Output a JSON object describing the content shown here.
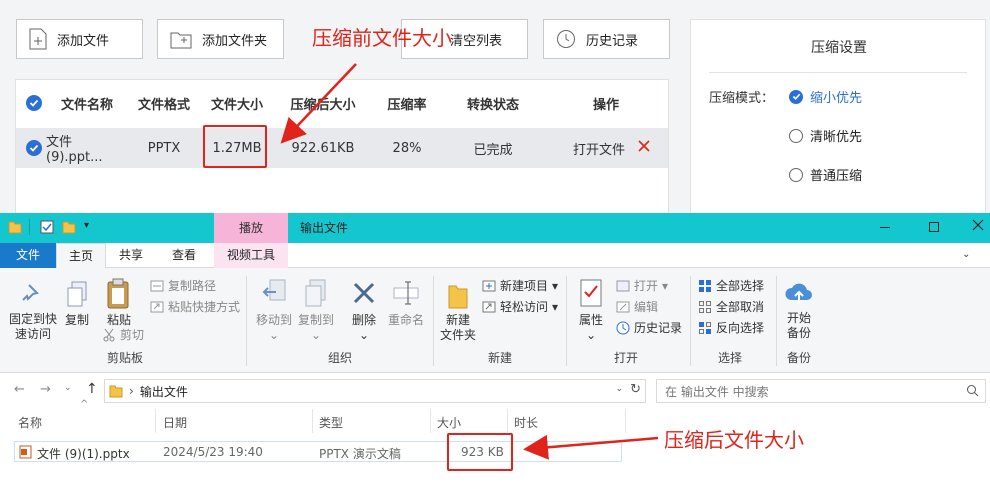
{
  "app": {
    "toolbar": {
      "add_file": "添加文件",
      "add_folder": "添加文件夹",
      "clear_list": "清空列表",
      "history": "历史记录"
    },
    "table": {
      "headers": [
        "文件名称",
        "文件格式",
        "文件大小",
        "压缩后大小",
        "压缩率",
        "转换状态",
        "操作"
      ],
      "row": {
        "name": "文件 (9).ppt...",
        "format": "PPTX",
        "size": "1.27MB",
        "compressed_size": "922.61KB",
        "ratio": "28%",
        "status": "已完成",
        "action": "打开文件"
      }
    },
    "settings": {
      "title": "压缩设置",
      "mode_label": "压缩模式：",
      "options": [
        "缩小优先",
        "清晰优先",
        "普通压缩"
      ],
      "selected": "缩小优先"
    }
  },
  "annotations": {
    "before": "压缩前文件大小",
    "after": "压缩后文件大小",
    "color": "#e0241b"
  },
  "explorer": {
    "context_tab": "播放",
    "title": "输出文件",
    "tabs": [
      "文件",
      "主页",
      "共享",
      "查看",
      "视频工具"
    ],
    "clipboard": {
      "pin": [
        "固定到快",
        "速访问"
      ],
      "copy": "复制",
      "paste": "粘贴",
      "copy_path": "复制路径",
      "paste_shortcut": "粘贴快捷方式",
      "cut": "剪切",
      "group": "剪贴板"
    },
    "organize": {
      "move_to": "移动到",
      "copy_to": "复制到",
      "delete": "删除",
      "rename": "重命名",
      "group": "组织"
    },
    "new": {
      "new_folder": [
        "新建",
        "文件夹"
      ],
      "new_item": "新建项目",
      "easy_access": "轻松访问",
      "group": "新建"
    },
    "open": {
      "properties": "属性",
      "open": "打开",
      "edit": "编辑",
      "history": "历史记录",
      "group": "打开"
    },
    "select": {
      "select_all": "全部选择",
      "select_none": "全部取消",
      "invert": "反向选择",
      "group": "选择"
    },
    "backup": {
      "start": [
        "开始",
        "备份"
      ],
      "group": "备份"
    },
    "address": "输出文件",
    "search_placeholder": "在 输出文件 中搜索",
    "columns": [
      "名称",
      "日期",
      "类型",
      "大小",
      "时长"
    ],
    "file": {
      "name": "文件 (9)(1).pptx",
      "date": "2024/5/23 19:40",
      "type": "PPTX 演示文稿",
      "size": "923 KB",
      "duration": ""
    }
  }
}
